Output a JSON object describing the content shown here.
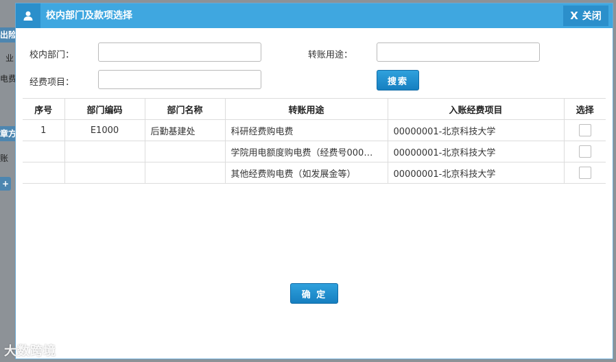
{
  "background": {
    "frag1": "出险",
    "frag2": "业",
    "frag3": "电费",
    "frag4": "章方",
    "frag5": "账",
    "frag6": "+",
    "watermark": "大数跨境"
  },
  "dialog": {
    "title": "校内部门及款项选择",
    "close_label": "关闭",
    "close_x": "X"
  },
  "form": {
    "dept_label": "校内部门：",
    "dept_value": "",
    "purpose_label": "转账用途：",
    "purpose_value": "",
    "project_label": "经费项目：",
    "project_value": "",
    "search_label": "搜索"
  },
  "table": {
    "headers": [
      "序号",
      "部门编码",
      "部门名称",
      "转账用途",
      "入账经费项目",
      "选择"
    ],
    "rows": [
      {
        "index": "1",
        "code": "E1000",
        "name": "后勤基建处",
        "purpose": "科研经费购电费",
        "project": "00000001-北京科技大学"
      },
      {
        "index": "",
        "code": "",
        "name": "",
        "purpose": "学院用电额度购电费（经费号000…",
        "project": "00000001-北京科技大学"
      },
      {
        "index": "",
        "code": "",
        "name": "",
        "purpose": "其他经费购电费（如发展金等）",
        "project": "00000001-北京科技大学"
      }
    ]
  },
  "confirm_label": "确 定",
  "colors": {
    "titlebar": "#3fa7e0",
    "titlebar_dark": "#2b8fcb",
    "button": "#167fc0"
  }
}
